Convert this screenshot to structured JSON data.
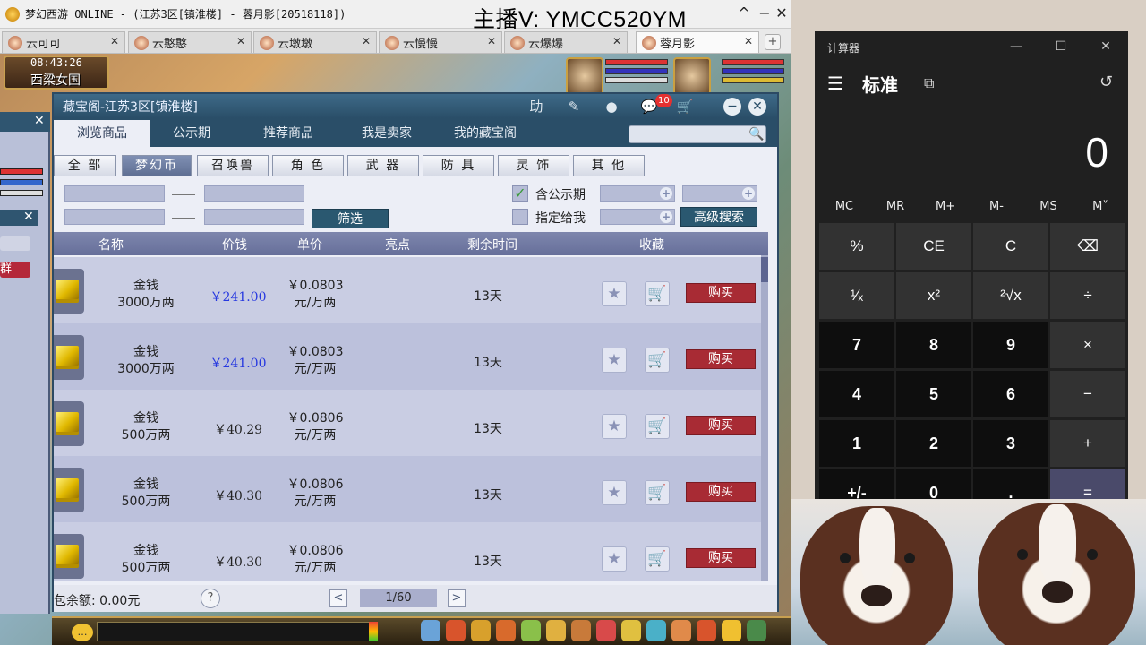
{
  "window": {
    "title": "梦幻西游 ONLINE - (江苏3区[镇淮楼] - 蓉月影[20518118])",
    "streamer_text": "主播V: YMCC520YM",
    "minimize": "^",
    "maximize": "−",
    "close": "✕"
  },
  "tabs": [
    {
      "label": "云可可",
      "active": false
    },
    {
      "label": "云憨憨",
      "active": false
    },
    {
      "label": "云墩墩",
      "active": false
    },
    {
      "label": "云慢慢",
      "active": false
    },
    {
      "label": "云爆爆",
      "active": false
    },
    {
      "label": "蓉月影",
      "active": true
    }
  ],
  "tab_close": "✕",
  "tab_add": "+",
  "game": {
    "clock": "08:43:26",
    "location": "西梁女国"
  },
  "left_panel": {
    "close": "✕",
    "button2": "群"
  },
  "panel": {
    "title": "藏宝阁-江苏3区[镇淮楼]",
    "help_label": "助",
    "pin_icon": "✎",
    "record_icon": "●",
    "chat_icon": "💬",
    "msg_count": "10",
    "cart_icon": "🛒",
    "minimize": "−",
    "close": "✕",
    "nav_tabs": [
      "浏览商品",
      "公示期",
      "推荐商品",
      "我是卖家",
      "我的藏宝阁"
    ],
    "search_icon": "🔍",
    "categories": [
      "全 部",
      "梦幻币",
      "召唤兽",
      "角 色",
      "武 器",
      "防 具",
      "灵 饰",
      "其 他"
    ],
    "filter_button": "筛选",
    "check_public": "含公示期",
    "check_public_mark": "✓",
    "check_assigned": "指定给我",
    "plus": "+",
    "advanced_search": "高级搜索",
    "columns": {
      "name": "名称",
      "price": "价钱",
      "unit_price": "单价",
      "highlight": "亮点",
      "remaining": "剩余时间",
      "favorite": "收藏"
    },
    "rows": [
      {
        "name": "金钱",
        "amount": "3000万两",
        "price": "￥241.00",
        "price_color": "#2638e0",
        "unit": "￥0.0803",
        "unit_suffix": "元/万两",
        "time": "13天"
      },
      {
        "name": "金钱",
        "amount": "3000万两",
        "price": "￥241.00",
        "price_color": "#2638e0",
        "unit": "￥0.0803",
        "unit_suffix": "元/万两",
        "time": "13天"
      },
      {
        "name": "金钱",
        "amount": "500万两",
        "price": "￥40.29",
        "price_color": "#222222",
        "unit": "￥0.0806",
        "unit_suffix": "元/万两",
        "time": "13天"
      },
      {
        "name": "金钱",
        "amount": "500万两",
        "price": "￥40.30",
        "price_color": "#222222",
        "unit": "￥0.0806",
        "unit_suffix": "元/万两",
        "time": "13天"
      },
      {
        "name": "金钱",
        "amount": "500万两",
        "price": "￥40.30",
        "price_color": "#222222",
        "unit": "￥0.0806",
        "unit_suffix": "元/万两",
        "time": "13天"
      }
    ],
    "star_icon": "★",
    "row_cart_icon": "🛒",
    "buy_label": "购买",
    "balance": "包余额: 0.00元",
    "help_q": "?",
    "prev": "<",
    "next": ">",
    "page": "1/60"
  },
  "bottom": {
    "chat_label": "…"
  },
  "calculator": {
    "title": "计算器",
    "minimize": "—",
    "maximize": "☐",
    "close": "✕",
    "menu_icon": "☰",
    "mode": "标准",
    "keep_on_top_icon": "⧉",
    "history_icon": "↺",
    "display": "0",
    "memory": [
      "MC",
      "MR",
      "M+",
      "M-",
      "MS",
      "M˅"
    ],
    "keys": [
      [
        "%",
        "CE",
        "C",
        "⌫"
      ],
      [
        "¹⁄ₓ",
        "x²",
        "²√x",
        "÷"
      ],
      [
        "7",
        "8",
        "9",
        "×"
      ],
      [
        "4",
        "5",
        "6",
        "−"
      ],
      [
        "1",
        "2",
        "3",
        "+"
      ],
      [
        "+/-",
        "0",
        ".",
        "="
      ]
    ]
  }
}
